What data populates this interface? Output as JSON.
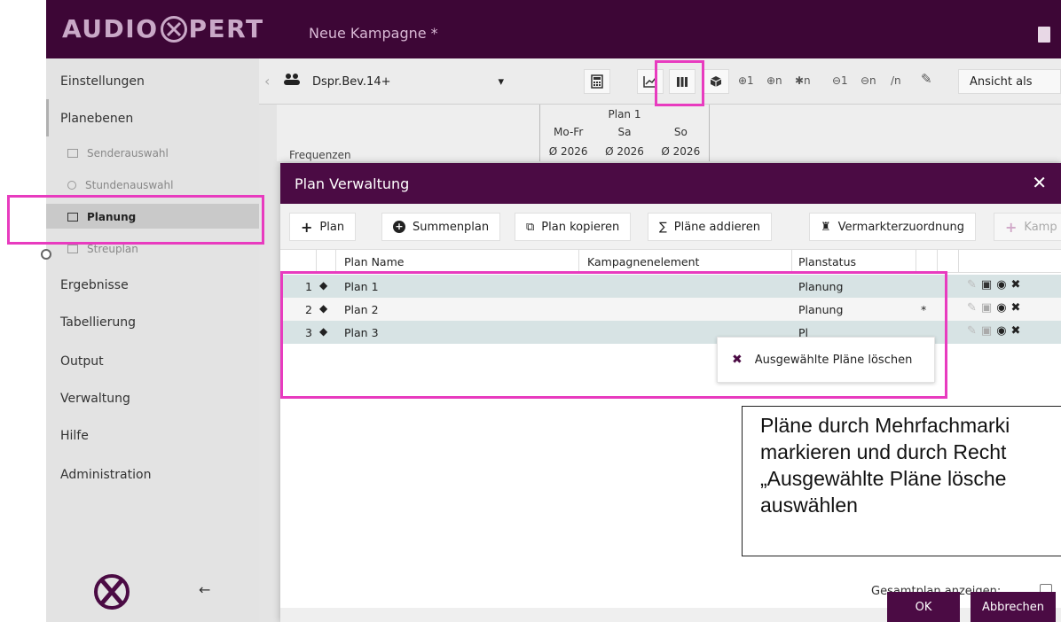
{
  "header": {
    "logo_text_left": "AUDIO",
    "logo_text_right": "PERT",
    "campaign_title": "Neue Kampagne *"
  },
  "sidebar": {
    "items": [
      {
        "label": "Einstellungen"
      },
      {
        "label": "Planebenen"
      },
      {
        "label": "Ergebnisse"
      },
      {
        "label": "Tabellierung"
      },
      {
        "label": "Output"
      },
      {
        "label": "Verwaltung"
      },
      {
        "label": "Hilfe"
      },
      {
        "label": "Administration"
      }
    ],
    "subitems": [
      {
        "label": "Senderauswahl"
      },
      {
        "label": "Stundenauswahl"
      },
      {
        "label": "Planung"
      },
      {
        "label": "Streuplan"
      }
    ]
  },
  "toolbar": {
    "target_group": "Dspr.Bev.14+",
    "tools": [
      "⊕1",
      "⊕n",
      "✱n",
      "⊖1",
      "⊖n",
      "/n"
    ],
    "view_as": "Ansicht als"
  },
  "grid": {
    "frequency_label": "Frequenzen",
    "plan_header": "Plan 1",
    "days": [
      "Mo-Fr",
      "Sa",
      "So"
    ],
    "averages": [
      "Ø 2026",
      "Ø 2026",
      "Ø 2026"
    ]
  },
  "modal": {
    "title": "Plan Verwaltung",
    "buttons": {
      "plan": "Plan",
      "summenplan": "Summenplan",
      "kopieren": "Plan kopieren",
      "addieren": "Pläne addieren",
      "vermarkter": "Vermarkterzuordnung",
      "kampagne": "Kamp"
    },
    "columns": {
      "name": "Plan Name",
      "element": "Kampagnenelement",
      "status": "Planstatus"
    },
    "rows": [
      {
        "num": "1",
        "name": "Plan 1",
        "status": "Planung",
        "mark": ""
      },
      {
        "num": "2",
        "name": "Plan 2",
        "status": "Planung",
        "mark": "*"
      },
      {
        "num": "3",
        "name": "Plan 3",
        "status": "Pl",
        "mark": ""
      }
    ],
    "context_menu": {
      "delete_selected": "Ausgewählte Pläne löschen"
    },
    "show_total": "Gesamtplan anzeigen:",
    "ok": "OK",
    "cancel": "Abbrechen"
  },
  "callout": {
    "lines": [
      "Pläne durch Mehrfachmarki",
      "markieren und durch Recht",
      "„Ausgewählte Pläne lösche",
      "auswählen"
    ]
  },
  "colors": {
    "brand_dark": "#3d0636",
    "modal_header": "#4b0b44",
    "highlight": "#e83bbf",
    "selected_row": "#d7e3e4"
  }
}
